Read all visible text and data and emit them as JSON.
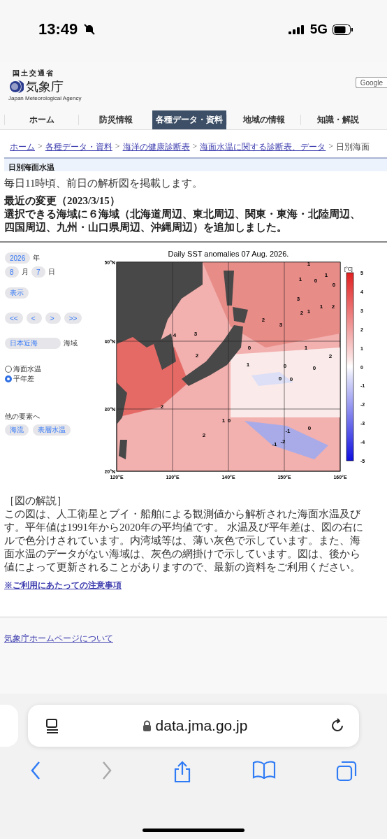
{
  "status_bar": {
    "time": "13:49",
    "network": "5G"
  },
  "header": {
    "ministry": "国土交通省",
    "agency": "気象庁",
    "agency_en": "Japan Meteorological Agency",
    "search_button": "Google"
  },
  "nav": [
    {
      "label": "ホーム",
      "selected": false
    },
    {
      "label": "防災情報",
      "selected": false
    },
    {
      "label": "各種データ・資料",
      "selected": true
    },
    {
      "label": "地域の情報",
      "selected": false
    },
    {
      "label": "知識・解説",
      "selected": false
    }
  ],
  "breadcrumb": {
    "links": [
      "ホーム",
      "各種データ・資料",
      "海洋の健康診断表",
      "海面水温に関する診断表、データ"
    ],
    "separator": ">",
    "current": "日別海面"
  },
  "page_title": "日別海面水温",
  "intro": "毎日11時頃、前日の解析図を掲載します。",
  "change_title": "最近の変更（2023/3/15）",
  "change_lines": [
    "選択できる海域に６海域（北海道周辺、東北周辺、関東・東海・北陸周辺、",
    "四国周辺、九州・山口県周辺、沖縄周辺）を追加しました。"
  ],
  "controls": {
    "year": "2026",
    "year_label": "年",
    "month": "8",
    "month_label": "月",
    "day": "7",
    "day_label": "日",
    "show_button": "表示",
    "step_buttons": [
      "<<",
      "<",
      ">",
      ">>"
    ],
    "area": "日本近海",
    "area_label": "海域",
    "radios": [
      {
        "label": "海面水温",
        "selected": false
      },
      {
        "label": "平年差",
        "selected": true
      }
    ],
    "other_label": "他の要素へ",
    "other_buttons": [
      "海流",
      "表層水温"
    ]
  },
  "map": {
    "title": "Daily SST anomalies 07 Aug. 2026.",
    "lat_labels": [
      "50°N",
      "40°N",
      "30°N",
      "20°N"
    ],
    "lon_labels": [
      "120°E",
      "130°E",
      "140°E",
      "150°E",
      "160°E"
    ],
    "unit": "[°C]",
    "scale_labels": [
      "5",
      "4",
      "3",
      "2",
      "1",
      "0",
      "-1",
      "-2",
      "-3",
      "-4",
      "-5"
    ],
    "contour_labels": [
      "4",
      "3",
      "2",
      "2",
      "2",
      "2",
      "3",
      "2",
      "1",
      "1",
      "2",
      "3",
      "1",
      "0",
      "1",
      "0",
      "1",
      "0",
      "1",
      "2",
      "1",
      "0",
      "0",
      "0",
      "0",
      "1",
      "0",
      "-1",
      "0",
      "-1",
      "-2"
    ]
  },
  "explanation": {
    "heading": "［図の解説］",
    "lines": [
      "この図は、人工衛星とブイ・船舶による観測値から解析された海面水温及び",
      "す。平年値は1991年から2020年の平均値です。 水温及び平年差は、図の右に",
      "ルで色分けされています。内湾域等は、薄い灰色で示しています。また、海",
      "面水温のデータがない海域は、灰色の網掛けで示しています。図は、後から",
      "値によって更新されることがありますので、最新の資料をご利用ください。"
    ],
    "notice_link": "※ご利用にあたっての注意事項"
  },
  "footer": {
    "link": "気象庁ホームページについて"
  },
  "browser": {
    "url": "data.jma.go.jp"
  }
}
